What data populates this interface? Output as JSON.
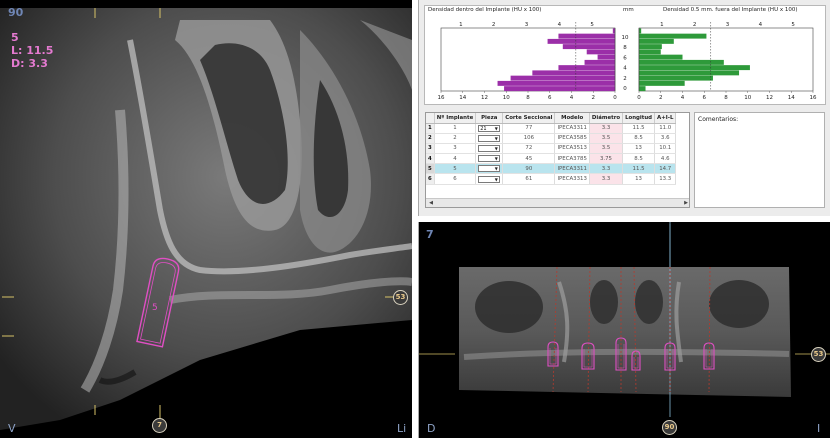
{
  "left_view": {
    "pane_number": "90",
    "implant_number": "5",
    "length_label": "L: 11.5",
    "diameter_label": "D: 3.3",
    "implant_tag": "5",
    "marker_right": "53",
    "marker_bottom": "7",
    "corner_left": "V",
    "corner_right": "Li"
  },
  "density_graphs": {
    "inside_title": "Densidad dentro del Implante (HU x 100)",
    "mm_label": "mm",
    "outside_title": "Densidad 0.5 mm. fuera del Implante (HU x 100)",
    "left_top_ticks": [
      "1",
      "2",
      "3",
      "4",
      "5"
    ],
    "right_top_ticks": [
      "1",
      "2",
      "3",
      "4",
      "5"
    ],
    "left_bottom_ticks": [
      "16",
      "14",
      "12",
      "10",
      "8",
      "6",
      "4",
      "2",
      "0"
    ],
    "right_bottom_ticks": [
      "0",
      "2",
      "4",
      "6",
      "8",
      "10",
      "12",
      "14",
      "16"
    ],
    "mm_ticks": [
      "10",
      "8",
      "6",
      "4",
      "2",
      "0"
    ],
    "inside_color": "#9b2fa8",
    "outside_color": "#2e9a3a"
  },
  "chart_data": [
    {
      "type": "bar",
      "title": "Densidad dentro del Implante (HU x 100)",
      "ylabel": "mm",
      "orientation": "horizontal",
      "y": [
        11,
        10,
        9,
        8,
        7,
        6,
        5,
        4,
        3,
        2,
        1,
        0
      ],
      "values": [
        0.2,
        5.2,
        6.2,
        4.8,
        2.6,
        1.6,
        2.8,
        5.2,
        7.6,
        9.6,
        10.8,
        10.2
      ],
      "xlim": [
        0,
        16
      ]
    },
    {
      "type": "bar",
      "title": "Densidad 0.5 mm. fuera del Implante (HU x 100)",
      "ylabel": "mm",
      "orientation": "horizontal",
      "y": [
        11,
        10,
        9,
        8,
        7,
        6,
        5,
        4,
        3,
        2,
        1,
        0
      ],
      "values": [
        0.2,
        6.2,
        3.2,
        2.1,
        2.0,
        4.0,
        7.8,
        10.2,
        9.2,
        6.8,
        4.2,
        0.6
      ],
      "xlim": [
        0,
        16
      ]
    }
  ],
  "table": {
    "headers": [
      "Nº Implante",
      "Pieza",
      "Corte Seccional",
      "Modelo",
      "Diámetro",
      "Longitud",
      "A+I-L"
    ],
    "rows": [
      {
        "row": "1",
        "num": "1",
        "pieza": "21",
        "corte": "77",
        "modelo": "IPECA3311",
        "diam": "3.3",
        "long": "11.5",
        "ail": "11.0"
      },
      {
        "row": "2",
        "num": "2",
        "pieza": "",
        "corte": "106",
        "modelo": "IPECA3585",
        "diam": "3.5",
        "long": "8.5",
        "ail": "3.6"
      },
      {
        "row": "3",
        "num": "3",
        "pieza": "",
        "corte": "72",
        "modelo": "IPECA3513",
        "diam": "3.5",
        "long": "13",
        "ail": "10.1"
      },
      {
        "row": "4",
        "num": "4",
        "pieza": "",
        "corte": "45",
        "modelo": "IPECA3785",
        "diam": "3.75",
        "long": "8.5",
        "ail": "4.6"
      },
      {
        "row": "5",
        "num": "5",
        "pieza": "",
        "corte": "90",
        "modelo": "IPECA3311",
        "diam": "3.3",
        "long": "11.5",
        "ail": "14.7"
      },
      {
        "row": "6",
        "num": "6",
        "pieza": "",
        "corte": "61",
        "modelo": "IPECA3313",
        "diam": "3.3",
        "long": "13",
        "ail": "13.3"
      }
    ],
    "selected_row": "5",
    "comments_label": "Comentarios:"
  },
  "bottom_view": {
    "pane_number": "7",
    "marker_right": "53",
    "marker_bottom": "90",
    "corner_left": "D",
    "corner_right": "I"
  }
}
